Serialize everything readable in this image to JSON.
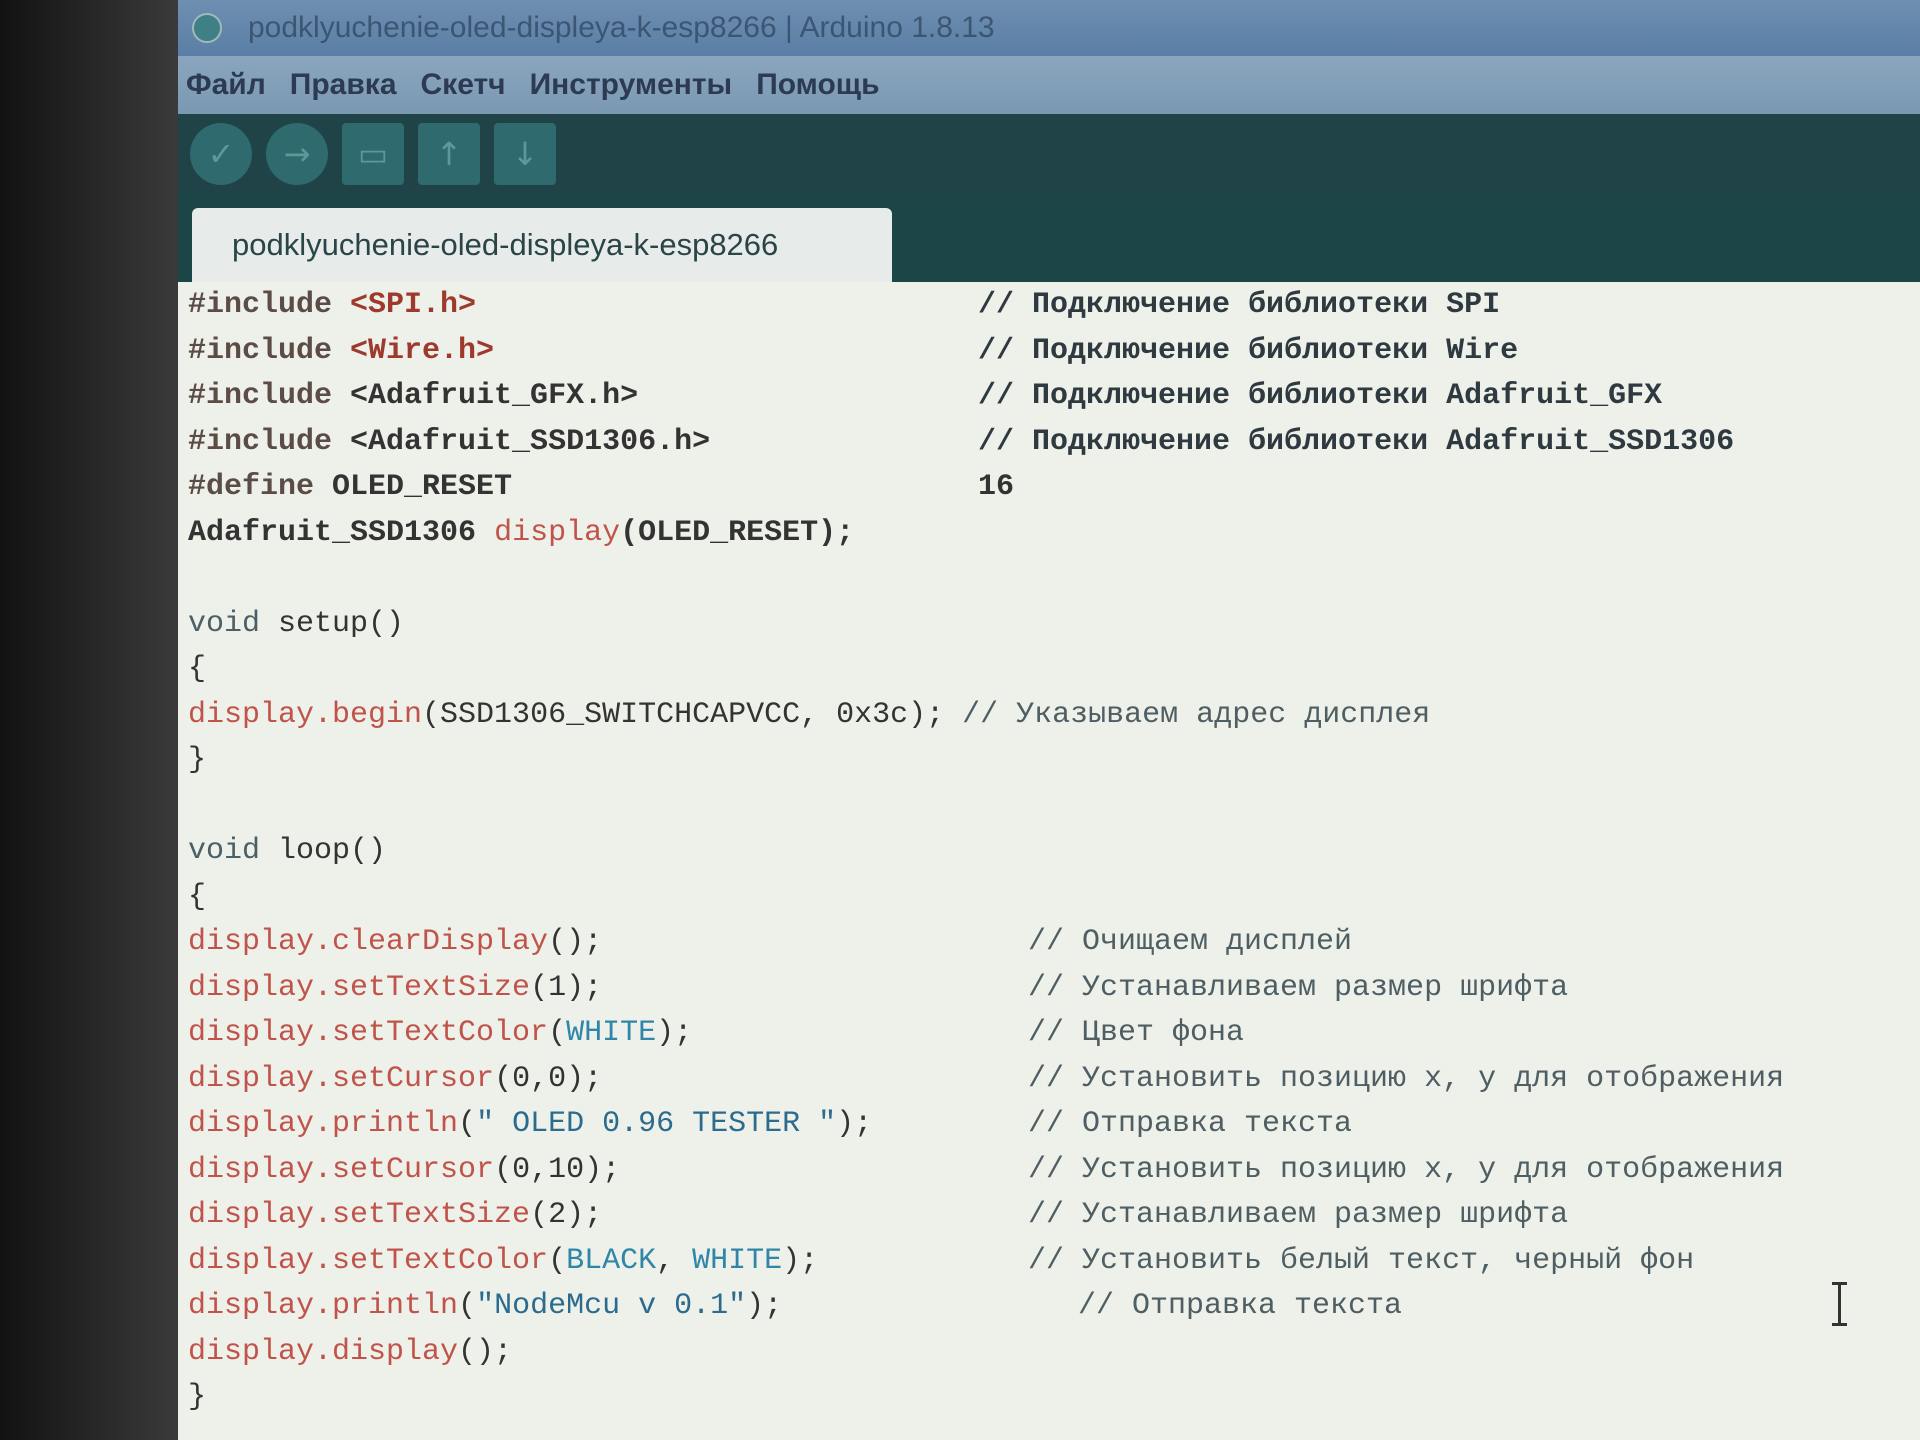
{
  "window": {
    "title": "podklyuchenie-oled-displeya-k-esp8266 | Arduino 1.8.13"
  },
  "menu": {
    "items": [
      {
        "label": "Файл"
      },
      {
        "label": "Правка"
      },
      {
        "label": "Скетч"
      },
      {
        "label": "Инструменты"
      },
      {
        "label": "Помощь"
      }
    ]
  },
  "toolbar": {
    "buttons": [
      {
        "name": "verify-button",
        "icon": "check-icon",
        "glyph": "✓"
      },
      {
        "name": "upload-button",
        "icon": "arrow-right-icon",
        "glyph": "→"
      },
      {
        "name": "new-button",
        "icon": "new-file-icon",
        "glyph": "▭"
      },
      {
        "name": "open-button",
        "icon": "arrow-up-icon",
        "glyph": "↑"
      },
      {
        "name": "save-button",
        "icon": "arrow-down-icon",
        "glyph": "↓"
      }
    ]
  },
  "tab": {
    "label": "podklyuchenie-oled-displeya-k-esp8266"
  },
  "editor": {
    "lines": [
      {
        "code": [
          {
            "t": "#include ",
            "c": "dir"
          },
          {
            "t": "<SPI.h>",
            "c": "inc"
          }
        ],
        "comment": "// Подключение библиотеки SPI",
        "ccls": "cm-bold",
        "col": 1
      },
      {
        "code": [
          {
            "t": "#include ",
            "c": "dir"
          },
          {
            "t": "<Wire.h>",
            "c": "inc"
          }
        ],
        "comment": "// Подключение библиотеки Wire",
        "ccls": "cm-bold",
        "col": 1
      },
      {
        "code": [
          {
            "t": "#include ",
            "c": "dir"
          },
          {
            "t": "<Adafruit_GFX.h>",
            "c": "plain"
          }
        ],
        "comment": "// Подключение библиотеки Adafruit_GFX",
        "ccls": "cm-bold",
        "col": 1
      },
      {
        "code": [
          {
            "t": "#include ",
            "c": "dir"
          },
          {
            "t": "<Adafruit_SSD1306.h>",
            "c": "plain"
          }
        ],
        "comment": "// Подключение библиотеки Adafruit_SSD1306",
        "ccls": "cm-bold",
        "col": 1
      },
      {
        "code": [
          {
            "t": "#define ",
            "c": "dir"
          },
          {
            "t": "OLED_RESET",
            "c": "plain"
          }
        ],
        "comment": "16",
        "ccls": "plain",
        "col": 1
      },
      {
        "code": [
          {
            "t": "Adafruit_SSD1306 ",
            "c": "plain"
          },
          {
            "t": "display",
            "c": "fn"
          },
          {
            "t": "(OLED_RESET);",
            "c": "plain"
          }
        ],
        "comment": "",
        "ccls": "cm",
        "col": 1
      },
      {
        "code": [],
        "comment": "",
        "ccls": "cm",
        "col": 1
      },
      {
        "code": [
          {
            "t": "void ",
            "c": "kw"
          },
          {
            "t": "setup()",
            "c": "paren"
          }
        ],
        "comment": "",
        "ccls": "cm",
        "col": 1
      },
      {
        "code": [
          {
            "t": "{",
            "c": "paren"
          }
        ],
        "comment": "",
        "ccls": "cm",
        "col": 1
      },
      {
        "code": [
          {
            "t": "display.begin",
            "c": "fn"
          },
          {
            "t": "(SSD1306_SWITCHCAPVCC, 0x3c);",
            "c": "paren"
          },
          {
            "t": " // Указываем адрес дисплея",
            "c": "cm"
          }
        ],
        "comment": "",
        "ccls": "cm",
        "col": 1
      },
      {
        "code": [
          {
            "t": "}",
            "c": "paren"
          }
        ],
        "comment": "",
        "ccls": "cm",
        "col": 1
      },
      {
        "code": [],
        "comment": "",
        "ccls": "cm",
        "col": 1
      },
      {
        "code": [
          {
            "t": "void ",
            "c": "kw"
          },
          {
            "t": "loop()",
            "c": "paren"
          }
        ],
        "comment": "",
        "ccls": "cm",
        "col": 1
      },
      {
        "code": [
          {
            "t": "{",
            "c": "paren"
          }
        ],
        "comment": "",
        "ccls": "cm",
        "col": 1
      },
      {
        "code": [
          {
            "t": "display.clearDisplay",
            "c": "fn"
          },
          {
            "t": "();",
            "c": "paren"
          }
        ],
        "comment": "// Очищаем дисплей",
        "ccls": "cm",
        "col": 2
      },
      {
        "code": [
          {
            "t": "display.setTextSize",
            "c": "fn"
          },
          {
            "t": "(1);",
            "c": "paren"
          }
        ],
        "comment": "// Устанавливаем размер шрифта",
        "ccls": "cm",
        "col": 2
      },
      {
        "code": [
          {
            "t": "display.setTextColor",
            "c": "fn"
          },
          {
            "t": "(",
            "c": "paren"
          },
          {
            "t": "WHITE",
            "c": "const"
          },
          {
            "t": ");",
            "c": "paren"
          }
        ],
        "comment": "// Цвет фона",
        "ccls": "cm",
        "col": 2
      },
      {
        "code": [
          {
            "t": "display.setCursor",
            "c": "fn"
          },
          {
            "t": "(0,0);",
            "c": "paren"
          }
        ],
        "comment": "// Установить позицию x, y для отображения",
        "ccls": "cm",
        "col": 2
      },
      {
        "code": [
          {
            "t": "display.println",
            "c": "fn"
          },
          {
            "t": "(",
            "c": "paren"
          },
          {
            "t": "\" OLED 0.96 TESTER \"",
            "c": "str"
          },
          {
            "t": ");",
            "c": "paren"
          }
        ],
        "comment": "// Отправка текста",
        "ccls": "cm",
        "col": 2
      },
      {
        "code": [
          {
            "t": "display.setCursor",
            "c": "fn"
          },
          {
            "t": "(0,10);",
            "c": "paren"
          }
        ],
        "comment": "// Установить позицию x, y для отображения",
        "ccls": "cm",
        "col": 2
      },
      {
        "code": [
          {
            "t": "display.setTextSize",
            "c": "fn"
          },
          {
            "t": "(2);",
            "c": "paren"
          }
        ],
        "comment": "// Устанавливаем размер шрифта",
        "ccls": "cm",
        "col": 2
      },
      {
        "code": [
          {
            "t": "display.setTextColor",
            "c": "fn"
          },
          {
            "t": "(",
            "c": "paren"
          },
          {
            "t": "BLACK",
            "c": "const"
          },
          {
            "t": ", ",
            "c": "paren"
          },
          {
            "t": "WHITE",
            "c": "const"
          },
          {
            "t": ");",
            "c": "paren"
          }
        ],
        "comment": "// Установить белый текст, черный фон",
        "ccls": "cm",
        "col": 2
      },
      {
        "code": [
          {
            "t": "display.println",
            "c": "fn"
          },
          {
            "t": "(",
            "c": "paren"
          },
          {
            "t": "\"NodeMcu v 0.1\"",
            "c": "str"
          },
          {
            "t": ");",
            "c": "paren"
          }
        ],
        "comment": "// Отправка текста",
        "ccls": "cm",
        "col": 3
      },
      {
        "code": [
          {
            "t": "display.display",
            "c": "fn"
          },
          {
            "t": "();",
            "c": "paren"
          }
        ],
        "comment": "",
        "ccls": "cm",
        "col": 1
      },
      {
        "code": [
          {
            "t": "}",
            "c": "paren"
          }
        ],
        "comment": "",
        "ccls": "cm",
        "col": 1
      }
    ]
  },
  "colors": {
    "title_bar": "#5a7ea5",
    "menu_bar": "#7b98b2",
    "toolbar": "#1f4346",
    "editor_bg": "#eef0ea",
    "function": "#c0544a",
    "constant": "#2f86a8",
    "include": "#9e3a2d"
  }
}
